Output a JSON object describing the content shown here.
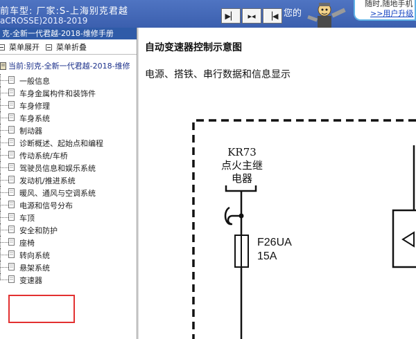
{
  "header": {
    "car_type": "前车型:  厂家:S-上海别克君越",
    "car_model": "aCROSSE)2018-2019",
    "mid_text": "您的",
    "promo_line1": "随时,随地手机",
    "promo_link": ">>用户升级"
  },
  "sidebar": {
    "manual_title": "克-全新一代君越-2018-维修手册",
    "expand_label": "菜单展开",
    "collapse_label": "菜单折叠",
    "current_label": "当前:别克-全新一代君越-2018-维修",
    "items": [
      {
        "label": "一般信息"
      },
      {
        "label": "车身金属构件和装饰件"
      },
      {
        "label": "车身修理"
      },
      {
        "label": "车身系统"
      },
      {
        "label": "制动器"
      },
      {
        "label": "诊断概述、起始点和编程"
      },
      {
        "label": "传动系统/车桥"
      },
      {
        "label": "驾驶员信息和娱乐系统"
      },
      {
        "label": "发动机/推进系统"
      },
      {
        "label": "暖风、通风与空调系统"
      },
      {
        "label": "电源和信号分布"
      },
      {
        "label": "车顶"
      },
      {
        "label": "安全和防护"
      },
      {
        "label": "座椅"
      },
      {
        "label": "转向系统"
      },
      {
        "label": "悬架系统"
      },
      {
        "label": "变速器"
      }
    ]
  },
  "document": {
    "title": "自动变速器控制示意图",
    "subtitle": "电源、搭铁、串行数据和信息显示",
    "relay_code": "KR73",
    "relay_name_1": "点火主继",
    "relay_name_2": "电器",
    "fuse_code": "F26UA",
    "fuse_rating": "15A"
  },
  "colors": {
    "banner": "#3b5fae",
    "highlight": "#e23030",
    "link": "#1040c0"
  }
}
